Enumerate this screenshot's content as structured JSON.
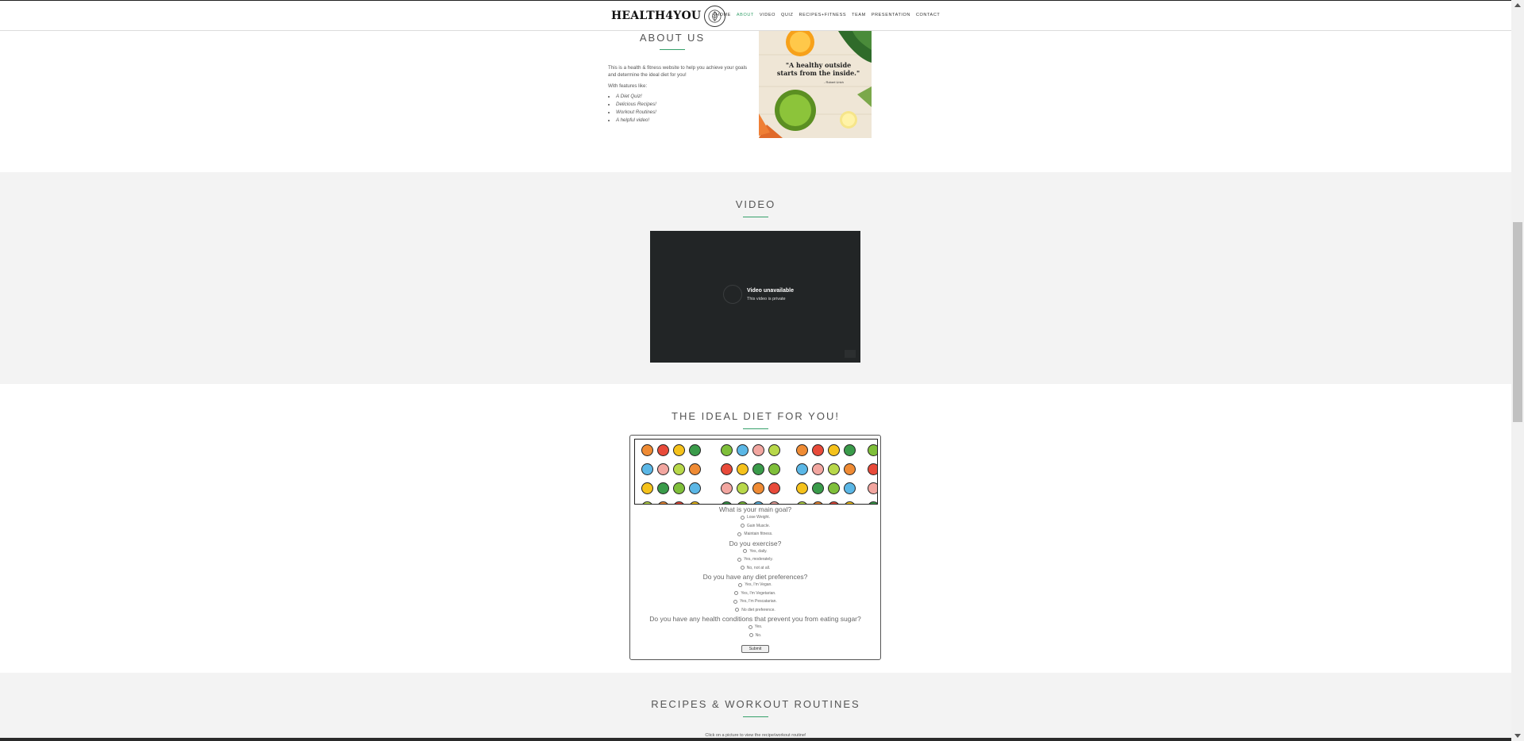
{
  "header": {
    "brand": "HEALTH4YOU",
    "nav": [
      {
        "label": "HOME",
        "active": false
      },
      {
        "label": "ABOUT",
        "active": true
      },
      {
        "label": "VIDEO",
        "active": false
      },
      {
        "label": "QUIZ",
        "active": false
      },
      {
        "label": "RECIPES+FITNESS",
        "active": false
      },
      {
        "label": "TEAM",
        "active": false
      },
      {
        "label": "PRESENTATION",
        "active": false
      },
      {
        "label": "CONTACT",
        "active": false
      }
    ]
  },
  "about": {
    "title": "ABOUT US",
    "intro": "This is a health & fitness website to help you achieve your goals and determine the ideal diet for you!",
    "features_label": "With features like:",
    "features": [
      "A Diet Quiz!",
      "Delicious Recipes!",
      "Workout Routines!",
      "A helpful video!"
    ],
    "image_quote": "\"A healthy outside starts from the inside.\"",
    "image_quote_author": "- Robert Urich"
  },
  "video": {
    "title": "VIDEO",
    "unavailable_title": "Video unavailable",
    "unavailable_sub": "This video is private"
  },
  "quiz": {
    "title": "THE IDEAL DIET FOR YOU!",
    "questions": [
      {
        "q": "What is your main goal?",
        "options": [
          "Lose Weight.",
          "Gain Muscle.",
          "Maintain fitness."
        ]
      },
      {
        "q": "Do you exercise?",
        "options": [
          "Yes, daily.",
          "Yes, moderately.",
          "No, not at all."
        ]
      },
      {
        "q": "Do you have any diet preferences?",
        "options": [
          "Yes, I'm Vegan.",
          "Yes, I'm Vegetarian.",
          "Yes, I'm Pescatarian.",
          "No diet preference."
        ]
      },
      {
        "q": "Do you have any health conditions that prevent you from eating sugar?",
        "options": [
          "Yes.",
          "No."
        ]
      }
    ],
    "submit_label": "Submit"
  },
  "recipes": {
    "title": "RECIPES & WORKOUT ROUTINES",
    "subtitle": "Click on a picture to view the recipe/workout routine!"
  },
  "colors": {
    "accent": "#35a06a",
    "section_gray": "#f3f3f3",
    "video_bg": "#222526"
  }
}
